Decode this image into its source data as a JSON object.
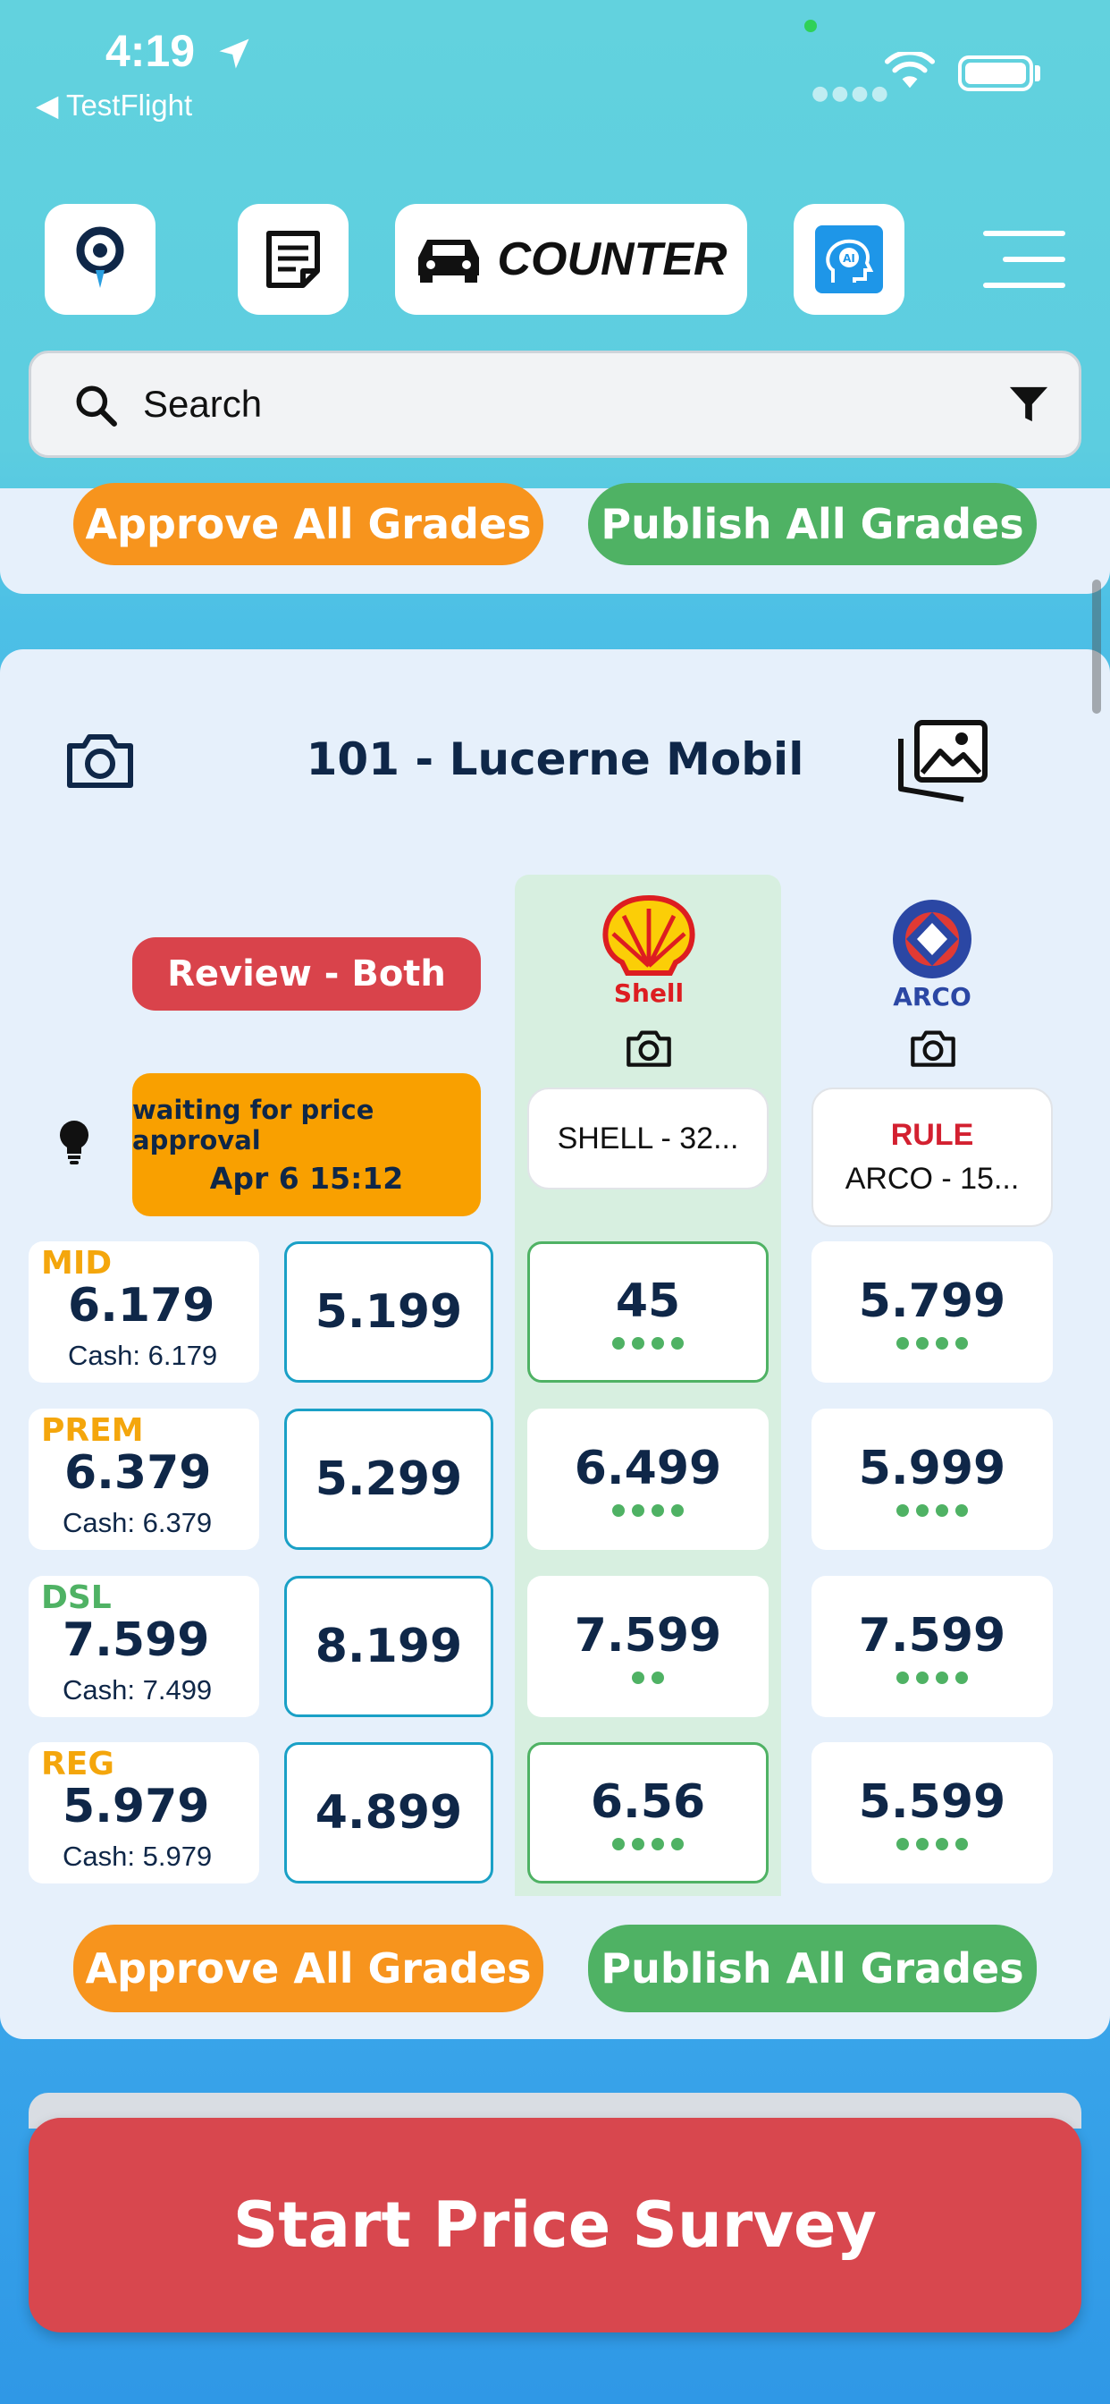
{
  "status_bar": {
    "time": "4:19",
    "back_app": "◀ TestFlight"
  },
  "toolbar": {
    "counter_label": "COUNTER"
  },
  "search": {
    "placeholder": "Search"
  },
  "actions": {
    "approve_label": "Approve All Grades",
    "publish_label": "Publish All Grades"
  },
  "station": {
    "title": "101 - Lucerne Mobil"
  },
  "status": {
    "review_label": "Review - Both",
    "waiting_line1": "waiting for price approval",
    "waiting_line2": "Apr 6 15:12"
  },
  "competitors": [
    {
      "brand": "Shell",
      "label": "SHELL - 32..."
    },
    {
      "brand": "ARCO",
      "rule": "RULE",
      "label": "ARCO - 15..."
    }
  ],
  "grades": [
    {
      "name": "MID",
      "price": "6.179",
      "cash": "Cash: 6.179",
      "input": "5.199",
      "shell": "45",
      "shell_dots": 4,
      "arco": "5.799",
      "arco_dots": 4
    },
    {
      "name": "PREM",
      "price": "6.379",
      "cash": "Cash: 6.379",
      "input": "5.299",
      "shell": "6.499",
      "shell_dots": 4,
      "arco": "5.999",
      "arco_dots": 4
    },
    {
      "name": "DSL",
      "price": "7.599",
      "cash": "Cash: 7.499",
      "input": "8.199",
      "shell": "7.599",
      "shell_dots": 2,
      "arco": "7.599",
      "arco_dots": 4
    },
    {
      "name": "REG",
      "price": "5.979",
      "cash": "Cash: 5.979",
      "input": "4.899",
      "shell": "6.56",
      "shell_dots": 4,
      "arco": "5.599",
      "arco_dots": 4
    }
  ],
  "colors": {
    "mid": "#f4a60c",
    "prem": "#f4a60c",
    "dsl": "#4fb264",
    "reg": "#f4a60c",
    "approve": "#f7941d",
    "publish": "#4fb264",
    "start": "#d8474e"
  },
  "footer": {
    "start_label": "Start Price Survey"
  }
}
